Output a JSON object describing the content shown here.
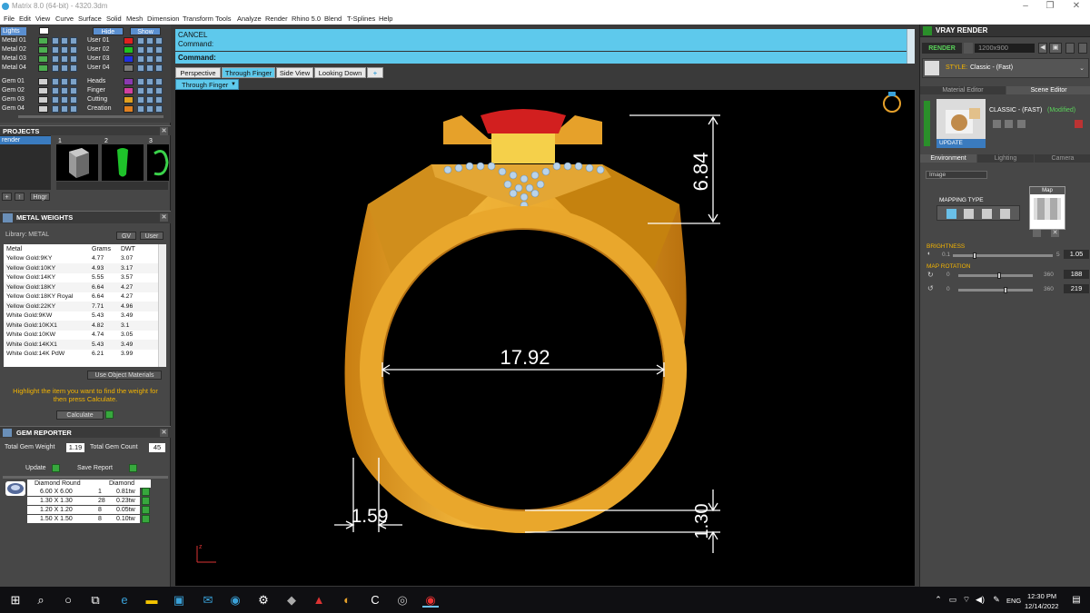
{
  "window": {
    "title": "Matrix 8.0 (64-bit) - 4320.3dm",
    "min": "–",
    "max": "❐",
    "close": "✕"
  },
  "menu": [
    "File",
    "Edit",
    "View",
    "Curve",
    "Surface",
    "Solid",
    "Mesh",
    "Dimension",
    "Transform",
    "Tools",
    "Analyze",
    "Render",
    "Rhino 5.0",
    "Blend",
    "T-Splines",
    "Help"
  ],
  "layers": {
    "left_header": "Lights",
    "hide_label": "Hide",
    "show_label": "Show",
    "left": [
      {
        "name": "Metal 01",
        "color": "#4caf50"
      },
      {
        "name": "Metal 02",
        "color": "#4caf50"
      },
      {
        "name": "Metal 03",
        "color": "#4caf50"
      },
      {
        "name": "Metal 04",
        "color": "#4caf50"
      },
      {
        "name": "Gem 01",
        "color": "#d0d0d0"
      },
      {
        "name": "Gem 02",
        "color": "#d0d0d0"
      },
      {
        "name": "Gem 03",
        "color": "#d0d0d0"
      },
      {
        "name": "Gem 04",
        "color": "#d0d0d0"
      }
    ],
    "right": [
      {
        "name": "User 01",
        "color": "#e02020"
      },
      {
        "name": "User 02",
        "color": "#20c020"
      },
      {
        "name": "User 03",
        "color": "#2030e0"
      },
      {
        "name": "User 04",
        "color": "#7a7a7a"
      },
      {
        "name": "Heads",
        "color": "#8a3ab0"
      },
      {
        "name": "Finger",
        "color": "#d040a0"
      },
      {
        "name": "Cutting",
        "color": "#e0a020"
      },
      {
        "name": "Creation",
        "color": "#e08020"
      }
    ]
  },
  "projects": {
    "header": "PROJECTS",
    "item": "render",
    "nums": [
      "1",
      "2",
      "3"
    ],
    "btn_plus": "+",
    "btn_up": "↑",
    "btn_hinge": "Hngr"
  },
  "metal_weights": {
    "header": "METAL WEIGHTS",
    "library": "Library: METAL",
    "gv_label": "GV",
    "user_label": "User",
    "columns": [
      "Metal",
      "Grams",
      "DWT"
    ],
    "rows": [
      [
        "Yellow Gold:9KY",
        "4.77",
        "3.07"
      ],
      [
        "Yellow Gold:10KY",
        "4.93",
        "3.17"
      ],
      [
        "Yellow Gold:14KY",
        "5.55",
        "3.57"
      ],
      [
        "Yellow Gold:18KY",
        "6.64",
        "4.27"
      ],
      [
        "Yellow Gold:18KY Royal",
        "6.64",
        "4.27"
      ],
      [
        "Yellow Gold:22KY",
        "7.71",
        "4.96"
      ],
      [
        "White Gold:9KW",
        "5.43",
        "3.49"
      ],
      [
        "White Gold:10KX1",
        "4.82",
        "3.1"
      ],
      [
        "White Gold:10KW",
        "4.74",
        "3.05"
      ],
      [
        "White Gold:14KX1",
        "5.43",
        "3.49"
      ],
      [
        "White Gold:14K PdW",
        "6.21",
        "3.99"
      ]
    ],
    "use_object": "Use Object Materials",
    "hint": "Highlight the item you want to find the weight for then press Calculate.",
    "calculate": "Calculate"
  },
  "gem_reporter": {
    "header": "GEM REPORTER",
    "total_weight_label": "Total Gem Weight",
    "total_weight": "1.19",
    "total_count_label": "Total Gem Count",
    "total_count": "45",
    "update": "Update",
    "save_report": "Save Report",
    "col1": "Diamond Round",
    "col2": "Diamond",
    "rows": [
      [
        "6.00 X 6.00",
        "1",
        "0.81tw"
      ],
      [
        "1.30 X 1.30",
        "28",
        "0.23tw"
      ],
      [
        "1.20 X 1.20",
        "8",
        "0.05tw"
      ],
      [
        "1.50 X 1.50",
        "8",
        "0.10tw"
      ]
    ]
  },
  "command": {
    "line1": "CANCEL",
    "line2": "Command:",
    "prompt": "Command:"
  },
  "view_tabs": [
    "Perspective",
    "Through Finger",
    "Side View",
    "Looking Down",
    "+"
  ],
  "active_tab": "Through Finger",
  "sub_view": "Through Finger",
  "dimensions": {
    "top": "6.84",
    "width": "17.92",
    "left": "1.59",
    "bottom": "1.30"
  },
  "vray": {
    "header": "VRAY RENDER",
    "render_btn": "RENDER",
    "resolution": "1200x900",
    "style_label": "STYLE:",
    "style_value": "Classic - (Fast)",
    "tab_material": "Material Editor",
    "tab_scene": "Scene Editor",
    "scene_name": "CLASSIC - (FAST)",
    "modified": "(Modified)",
    "update": "UPDATE",
    "env_tabs": [
      "Environment",
      "Lighting",
      "Camera"
    ],
    "image_select": "Image",
    "map_label": "Map",
    "mapping_type": "MAPPING TYPE",
    "brightness_label": "BRIGHTNESS",
    "brightness_min": "0.1",
    "brightness_max": "5",
    "brightness_val": "1.05",
    "brightness_frac": 0.2,
    "rotation_label": "MAP ROTATION",
    "rot1_min": "0",
    "rot1_max": "360",
    "rot1_val": "188",
    "rot2_min": "0",
    "rot2_max": "360",
    "rot2_val": "219"
  },
  "taskbar": {
    "lang": "ENG",
    "time": "12:30 PM",
    "date": "12/14/2022"
  },
  "colors": {
    "accent": "#5ec9ec",
    "gold": "#e6a12a",
    "ruby": "#d21f1f",
    "panel": "#474747"
  }
}
